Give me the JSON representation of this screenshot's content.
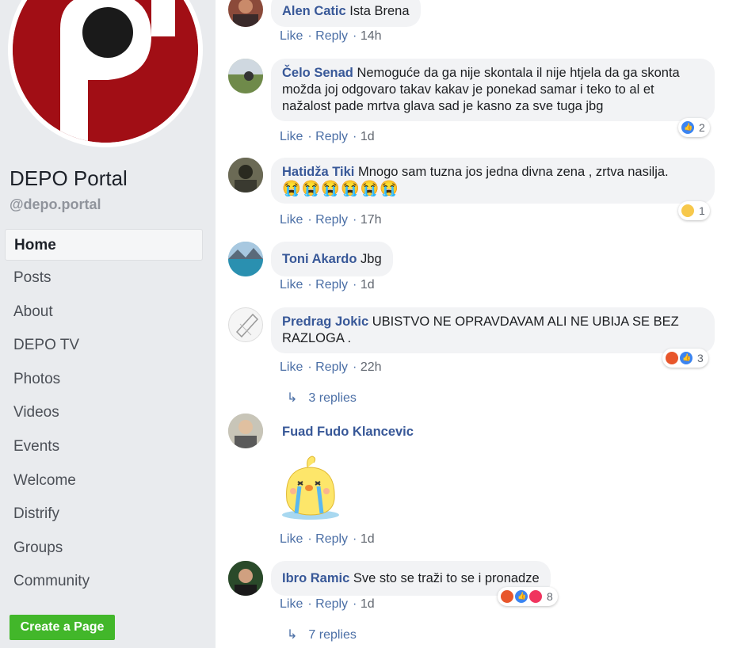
{
  "sidebar": {
    "page_name": "DEPO Portal",
    "handle": "@depo.portal",
    "nav": [
      "Home",
      "Posts",
      "About",
      "DEPO TV",
      "Photos",
      "Videos",
      "Events",
      "Welcome",
      "Distrify",
      "Groups",
      "Community"
    ],
    "create_page": "Create a Page"
  },
  "labels": {
    "like": "Like",
    "reply": "Reply"
  },
  "comments": [
    {
      "author": "Alen Catic",
      "text": "Ista Brena",
      "time": "14h"
    },
    {
      "author": "Čelo Senad",
      "text": "Nemoguće da ga nije skontala il nije htjela da ga skonta možda joj odgovaro takav kakav je ponekad samar i teko to al et nažalost pade mrtva glava sad je kasno za sve tuga jbg",
      "time": "1d",
      "reactions": {
        "types": [
          "like"
        ],
        "count": "2"
      }
    },
    {
      "author": "Hatidža Tiki",
      "text": "Mnogo sam tuzna jos jedna divna zena , zrtva nasilja.",
      "emoji": "😭😭😭😭😭😭",
      "time": "17h",
      "reactions": {
        "types": [
          "sad"
        ],
        "count": "1"
      }
    },
    {
      "author": "Toni Akardo",
      "text": "Jbg",
      "time": "1d"
    },
    {
      "author": "Predrag Jokic",
      "text": "UBISTVO NE OPRAVDAVAM ALI NE UBIJA SE BEZ RAZLOGA .",
      "time": "22h",
      "reactions": {
        "types": [
          "angry",
          "like"
        ],
        "count": "3"
      },
      "replies": "3 replies"
    },
    {
      "author": "Fuad Fudo Klancevic",
      "text": "",
      "time": "1d",
      "sticker": "crying-chick"
    },
    {
      "author": "Ibro Ramic",
      "text": "Sve sto se traži to se i pronadze",
      "time": "1d",
      "reactions": {
        "types": [
          "angry",
          "like",
          "love"
        ],
        "count": "8"
      },
      "replies": "7 replies"
    }
  ]
}
